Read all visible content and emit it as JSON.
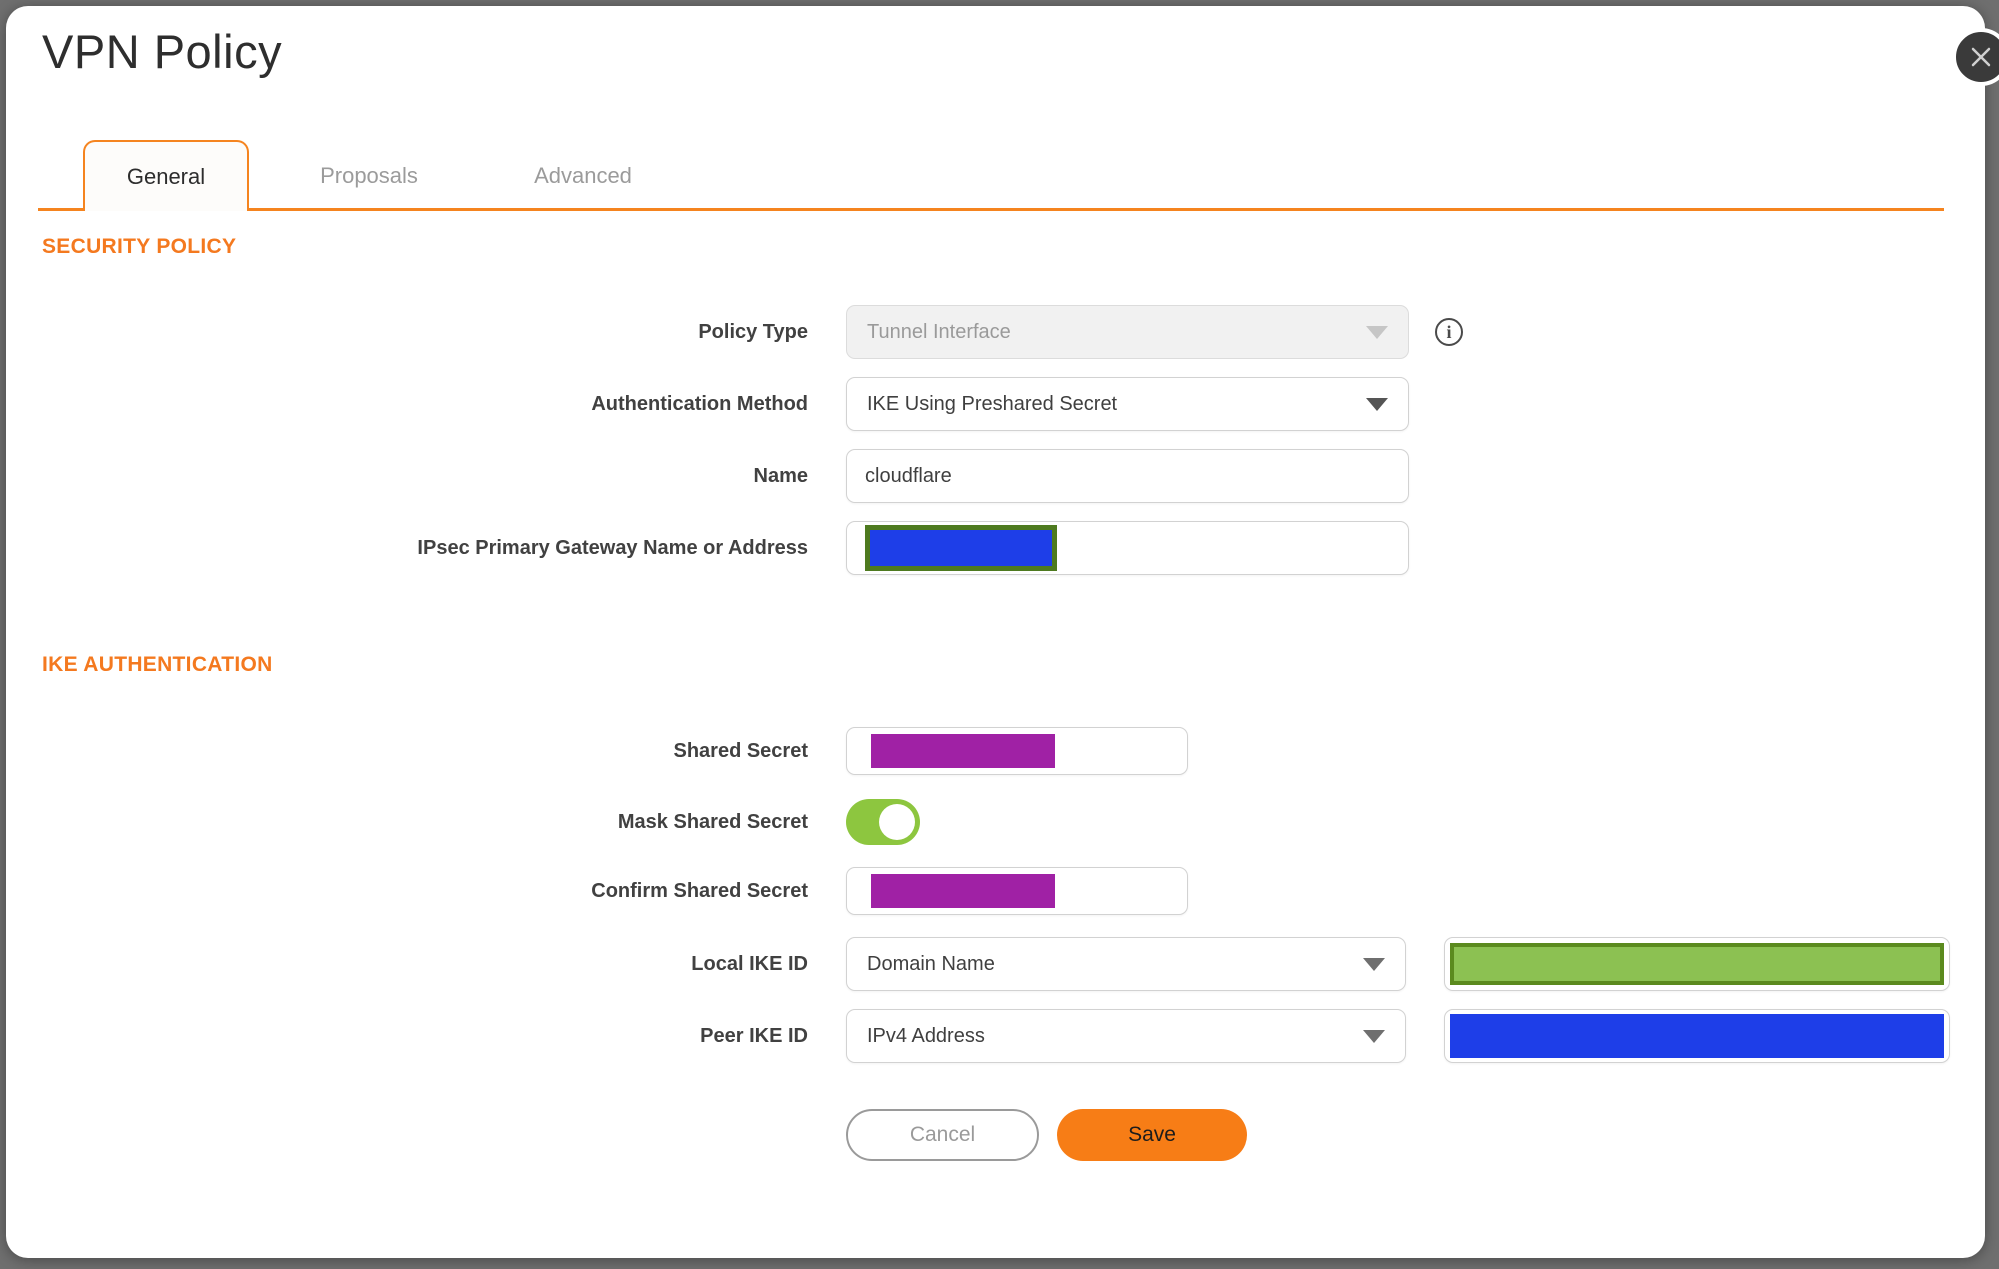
{
  "dialog": {
    "title": "VPN Policy"
  },
  "tabs": [
    {
      "label": "General",
      "active": true
    },
    {
      "label": "Proposals",
      "active": false
    },
    {
      "label": "Advanced",
      "active": false
    }
  ],
  "sections": {
    "security_policy": "SECURITY POLICY",
    "ike_authentication": "IKE AUTHENTICATION"
  },
  "fields": {
    "policy_type": {
      "label": "Policy Type",
      "value": "Tunnel Interface",
      "disabled": true
    },
    "authentication_method": {
      "label": "Authentication Method",
      "value": "IKE Using Preshared Secret"
    },
    "name": {
      "label": "Name",
      "value": "cloudflare"
    },
    "ipsec_primary_gateway": {
      "label": "IPsec Primary Gateway Name or Address",
      "value_state": "redacted"
    },
    "shared_secret": {
      "label": "Shared Secret",
      "value_state": "redacted"
    },
    "mask_shared_secret": {
      "label": "Mask Shared Secret",
      "state": "on"
    },
    "confirm_shared_secret": {
      "label": "Confirm Shared Secret",
      "value_state": "redacted"
    },
    "local_ike_id": {
      "label": "Local IKE ID",
      "selected_type": "Domain Name",
      "value_state": "redacted"
    },
    "peer_ike_id": {
      "label": "Peer IKE ID",
      "selected_type": "IPv4 Address",
      "value_state": "redacted"
    }
  },
  "buttons": {
    "cancel": "Cancel",
    "save": "Save"
  },
  "colors": {
    "accent_orange": "#F5841F",
    "save_button_orange": "#F77D16",
    "toggle_green": "#8DC63F",
    "redaction_purple": "#A021A5",
    "redaction_blue": "#1E3EE8",
    "redaction_green_fill": "#8CC152",
    "backdrop_gray": "#6F6F6F"
  }
}
